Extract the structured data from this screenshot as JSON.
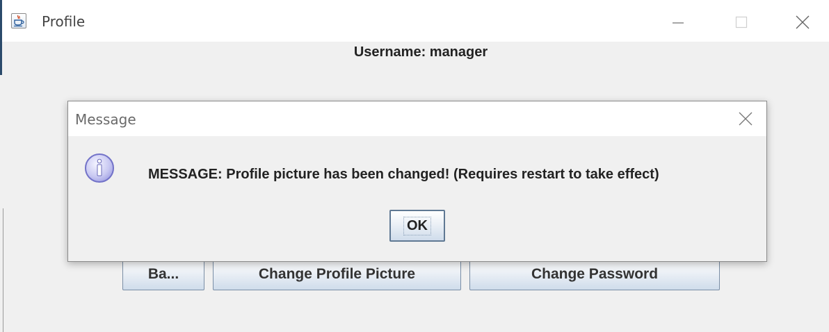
{
  "window": {
    "title": "Profile",
    "icon": "java-coffee-icon",
    "controls": {
      "minimize_icon": "minimize-icon",
      "maximize_icon": "maximize-icon",
      "close_icon": "close-icon"
    }
  },
  "content": {
    "username_label": "Username: manager"
  },
  "buttons": {
    "back_label": "Ba...",
    "change_picture_label": "Change Profile Picture",
    "change_password_label": "Change Password"
  },
  "dialog": {
    "title": "Message",
    "close_icon": "close-icon",
    "info_icon": "information-icon",
    "message": "MESSAGE: Profile picture has been changed! (Requires restart to take effect)",
    "ok_label": "OK"
  },
  "colors": {
    "window_bg": "#f0f0f0",
    "titlebar_bg": "#ffffff",
    "button_border": "#7a8ea6",
    "info_icon_fill": "#c9c9f2",
    "info_icon_stroke": "#7272c8"
  }
}
